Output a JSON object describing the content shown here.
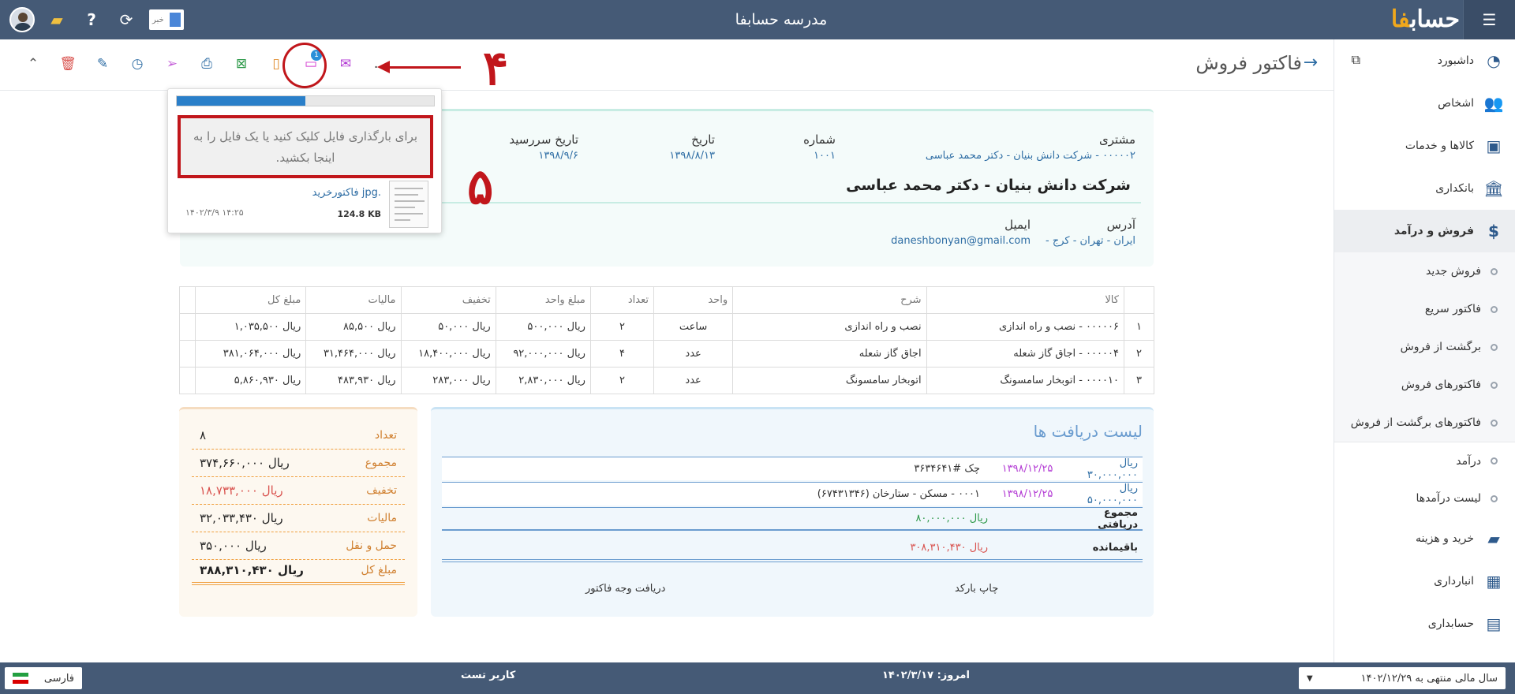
{
  "app": {
    "title": "مدرسه حسابفا",
    "logo_main": "حساب",
    "logo_accent": "فا"
  },
  "topbar": {
    "news_label": "خبر"
  },
  "sidebar": {
    "items": [
      {
        "label": "داشبورد"
      },
      {
        "label": "اشخاص"
      },
      {
        "label": "کالاها و خدمات"
      },
      {
        "label": "بانکداری"
      },
      {
        "label": "فروش و درآمد"
      },
      {
        "label": "خرید و هزینه"
      },
      {
        "label": "انبارداری"
      },
      {
        "label": "حسابداری"
      }
    ],
    "sales_sub": [
      {
        "label": "فروش جدید"
      },
      {
        "label": "فاکتور سریع"
      },
      {
        "label": "برگشت از فروش"
      },
      {
        "label": "فاکتورهای فروش"
      },
      {
        "label": "فاکتورهای برگشت از فروش"
      }
    ],
    "income_sub": [
      {
        "label": "درآمد"
      },
      {
        "label": "لیست درآمدها"
      }
    ]
  },
  "page": {
    "title": "فاکتور فروش"
  },
  "toolbar": {
    "more": "...",
    "attachments_count": "1"
  },
  "annotations": {
    "step4": "۴",
    "step5": "۵"
  },
  "upload": {
    "progress": 0.5,
    "dropzone_text": "برای بارگذاری فایل کلیک کنید یا یک فایل را به اینجا بکشید.",
    "file_name": ".jpg فاکتورخرید",
    "file_size": "124.8 KB",
    "file_time": "۱۴۰۲/۳/۹ ۱۴:۲۵"
  },
  "invoice": {
    "customer_label": "مشتری",
    "customer_value": "۰۰۰۰۰۲ - شرکت دانش بنیان - دکتر محمد عباسی",
    "number_label": "شماره",
    "number_value": "۱۰۰۱",
    "date_label": "تاریخ",
    "date_value": "۱۳۹۸/۸/۱۳",
    "due_label": "تاریخ سررسید",
    "due_value": "۱۳۹۸/۹/۶",
    "company": "شرکت دانش بنیان - دکتر محمد عباسی",
    "address_label": "آدرس",
    "address_value": "ایران - تهران - کرج -",
    "email_label": "ایمیل",
    "email_value": "daneshbonyan@gmail.com"
  },
  "table": {
    "headers": [
      "",
      "کالا",
      "شرح",
      "واحد",
      "تعداد",
      "مبلغ واحد",
      "تخفیف",
      "مالیات",
      "مبلغ کل",
      ""
    ],
    "rows": [
      [
        "۱",
        "۰۰۰۰۰۶ - نصب و راه اندازی",
        "نصب و راه اندازی",
        "ساعت",
        "۲",
        "ریال ۵۰۰,۰۰۰",
        "ریال ۵۰,۰۰۰",
        "ریال ۸۵,۵۰۰",
        "ریال ۱,۰۳۵,۵۰۰"
      ],
      [
        "۲",
        "۰۰۰۰۰۴ - اجاق گاز شعله",
        "اجاق گاز شعله",
        "عدد",
        "۴",
        "ریال ۹۲,۰۰۰,۰۰۰",
        "ریال ۱۸,۴۰۰,۰۰۰",
        "ریال ۳۱,۴۶۴,۰۰۰",
        "ریال ۳۸۱,۰۶۴,۰۰۰"
      ],
      [
        "۳",
        "۰۰۰۰۱۰ - اتوبخار سامسونگ",
        "اتوبخار سامسونگ",
        "عدد",
        "۲",
        "ریال ۲,۸۳۰,۰۰۰",
        "ریال ۲۸۳,۰۰۰",
        "ریال ۴۸۳,۹۳۰",
        "ریال ۵,۸۶۰,۹۳۰"
      ]
    ]
  },
  "receipts": {
    "title": "لیست دریافت ها",
    "rows": [
      {
        "amount": "ریال ۳۰,۰۰۰,۰۰۰",
        "date": "۱۳۹۸/۱۲/۲۵",
        "desc": "چک #۳۶۳۴۶۴۱"
      },
      {
        "amount": "ریال ۵۰,۰۰۰,۰۰۰",
        "date": "۱۳۹۸/۱۲/۲۵",
        "desc": "۰۰۰۱ - مسکن - ستارخان (۶۷۴۳۱۳۴۶)"
      }
    ],
    "total_label": "مجموع دریافتی",
    "total_value": "ریال ۸۰,۰۰۰,۰۰۰",
    "remain_label": "باقیمانده",
    "remain_value": "ریال ۳۰۸,۳۱۰,۴۳۰",
    "print_barcode": "چاپ بارکد",
    "receive_payment": "دریافت وجه فاکتور"
  },
  "summary": [
    {
      "k": "تعداد",
      "v": "۸"
    },
    {
      "k": "مجموع",
      "v": "ریال ۳۷۴,۶۶۰,۰۰۰"
    },
    {
      "k": "تخفیف",
      "v": "ریال ۱۸,۷۳۳,۰۰۰"
    },
    {
      "k": "مالیات",
      "v": "ریال ۳۲,۰۳۳,۴۳۰"
    },
    {
      "k": "حمل و نقل",
      "v": "ریال ۳۵۰,۰۰۰"
    },
    {
      "k": "مبلغ کل",
      "v": "ریال ۳۸۸,۳۱۰,۴۳۰"
    }
  ],
  "footer": {
    "fiscal_year": "سال مالی منتهی به ۱۴۰۲/۱۲/۲۹",
    "today_label": "امروز:",
    "today_value": "۱۴۰۲/۳/۱۷",
    "user": "کاربر تست",
    "language": "فارسی"
  },
  "colors": {
    "topbar": "#455a76",
    "accent": "#2e6da4",
    "annotation": "#c1161b"
  }
}
